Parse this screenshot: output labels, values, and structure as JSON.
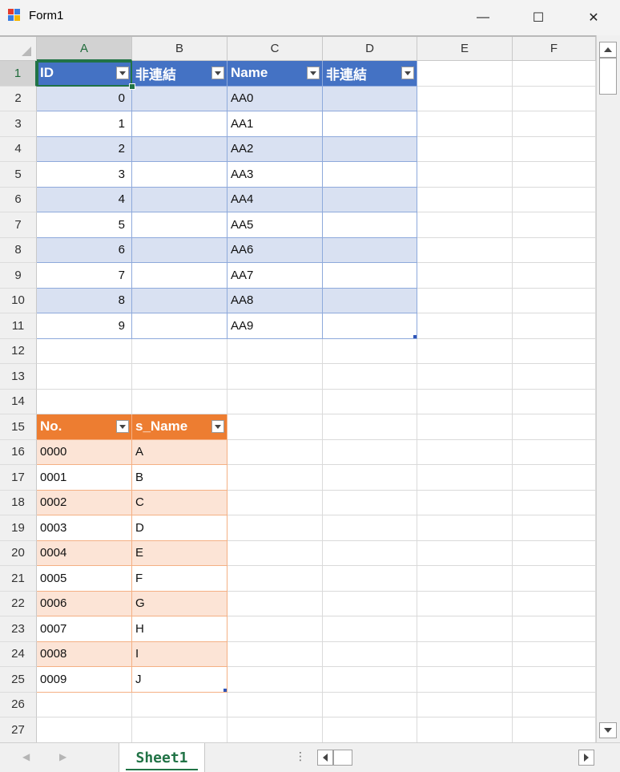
{
  "window": {
    "title": "Form1",
    "minimize_glyph": "—",
    "maximize_glyph": "☐",
    "close_glyph": "✕"
  },
  "columns": [
    "A",
    "B",
    "C",
    "D",
    "E",
    "F"
  ],
  "rows": [
    "1",
    "2",
    "3",
    "4",
    "5",
    "6",
    "7",
    "8",
    "9",
    "10",
    "11",
    "12",
    "13",
    "14",
    "15",
    "16",
    "17",
    "18",
    "19",
    "20",
    "21",
    "22",
    "23",
    "24",
    "25",
    "26",
    "27"
  ],
  "active_cell": "A1",
  "table1": {
    "headers": [
      "ID",
      "非連結",
      "Name",
      "非連結"
    ],
    "rows": [
      [
        "0",
        "",
        "AA0",
        ""
      ],
      [
        "1",
        "",
        "AA1",
        ""
      ],
      [
        "2",
        "",
        "AA2",
        ""
      ],
      [
        "3",
        "",
        "AA3",
        ""
      ],
      [
        "4",
        "",
        "AA4",
        ""
      ],
      [
        "5",
        "",
        "AA5",
        ""
      ],
      [
        "6",
        "",
        "AA6",
        ""
      ],
      [
        "7",
        "",
        "AA7",
        ""
      ],
      [
        "8",
        "",
        "AA8",
        ""
      ],
      [
        "9",
        "",
        "AA9",
        ""
      ]
    ],
    "header_color": "#4472c4",
    "band_color": "#d9e1f2"
  },
  "table2": {
    "headers": [
      "No.",
      "s_Name"
    ],
    "rows": [
      [
        "0000",
        "A"
      ],
      [
        "0001",
        "B"
      ],
      [
        "0002",
        "C"
      ],
      [
        "0003",
        "D"
      ],
      [
        "0004",
        "E"
      ],
      [
        "0005",
        "F"
      ],
      [
        "0006",
        "G"
      ],
      [
        "0007",
        "H"
      ],
      [
        "0008",
        "I"
      ],
      [
        "0009",
        "J"
      ]
    ],
    "header_color": "#ed7d31",
    "band_color": "#fce4d6"
  },
  "sheet_tabs": [
    "Sheet1"
  ],
  "icons": [
    "app-icon",
    "minimize-icon",
    "maximize-icon",
    "close-icon",
    "dropdown-arrow-icon",
    "scroll-up-icon",
    "scroll-down-icon",
    "scroll-left-icon",
    "scroll-right-icon"
  ],
  "accent_color": "#217346"
}
